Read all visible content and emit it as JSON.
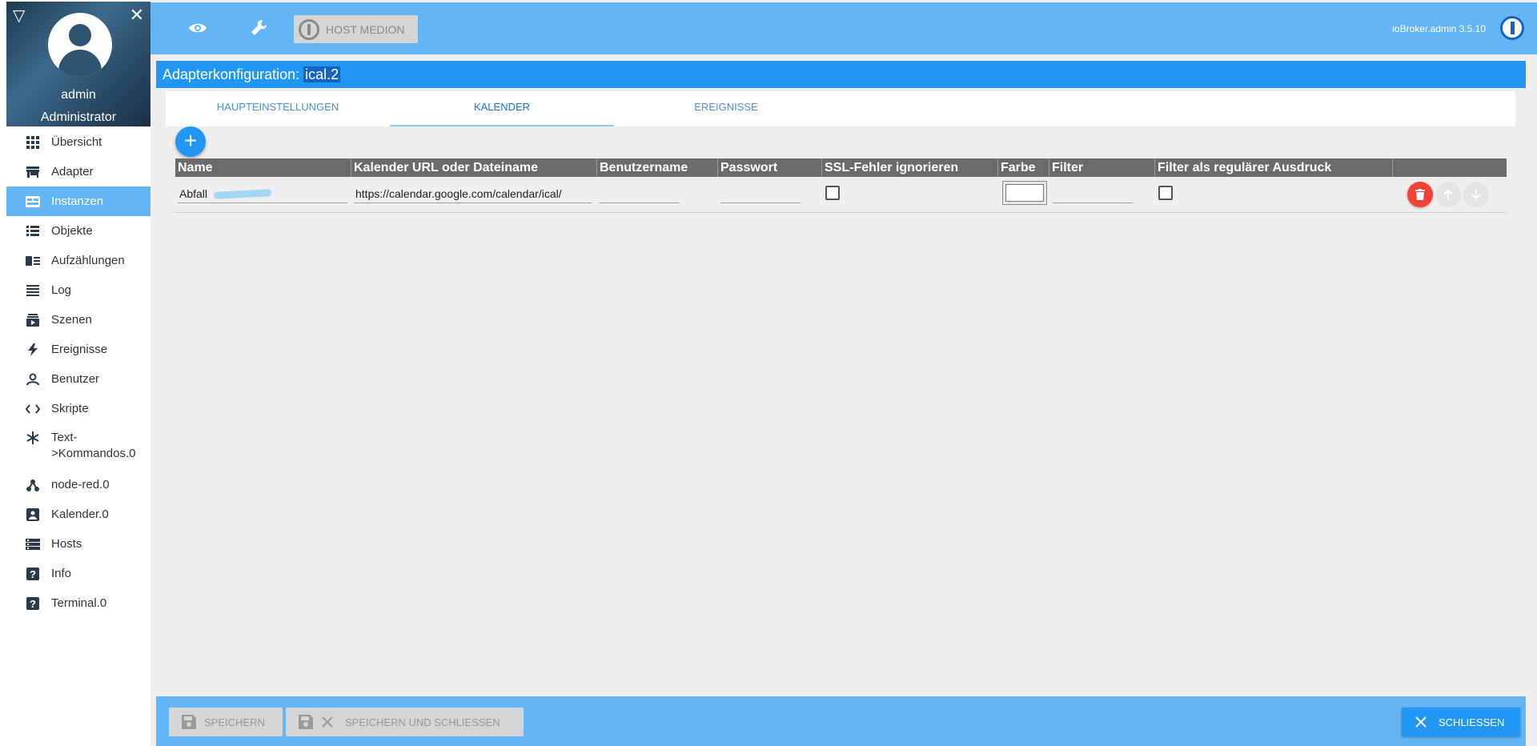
{
  "sidebar": {
    "user": {
      "name": "admin",
      "role": "Administrator"
    },
    "items": [
      {
        "label": "Übersicht",
        "icon": "grid-icon"
      },
      {
        "label": "Adapter",
        "icon": "store-icon"
      },
      {
        "label": "Instanzen",
        "icon": "instances-icon",
        "active": true
      },
      {
        "label": "Objekte",
        "icon": "list-icon"
      },
      {
        "label": "Aufzählungen",
        "icon": "enum-icon"
      },
      {
        "label": "Log",
        "icon": "log-icon"
      },
      {
        "label": "Szenen",
        "icon": "scenes-icon"
      },
      {
        "label": "Ereignisse",
        "icon": "flash-icon"
      },
      {
        "label": "Benutzer",
        "icon": "user-icon"
      },
      {
        "label": "Skripte",
        "icon": "code-icon"
      },
      {
        "label1": "Text-",
        "label2": ">Kommandos.0",
        "icon": "snowflake-icon"
      },
      {
        "label": "node-red.0",
        "icon": "nodes-icon"
      },
      {
        "label": "Kalender.0",
        "icon": "calendar-icon"
      },
      {
        "label": "Hosts",
        "icon": "server-icon"
      },
      {
        "label": "Info",
        "icon": "help-icon"
      },
      {
        "label": "Terminal.0",
        "icon": "terminal-icon"
      }
    ]
  },
  "topbar": {
    "host_label": "HOST MEDION",
    "version": "ioBroker.admin 3.5.10"
  },
  "adapter": {
    "title_prefix": "Adapterkonfiguration:",
    "instance": "ical.2"
  },
  "tabs": [
    {
      "label": "HAUPTEINSTELLUNGEN"
    },
    {
      "label": "KALENDER",
      "active": true
    },
    {
      "label": "EREIGNISSE"
    }
  ],
  "table": {
    "headers": {
      "name": "Name",
      "url": "Kalender URL oder Dateiname",
      "user": "Benutzername",
      "password": "Passwort",
      "ssl": "SSL-Fehler ignorieren",
      "color": "Farbe",
      "filter": "Filter",
      "regex": "Filter als regulärer Ausdruck"
    },
    "rows": [
      {
        "name": "Abfall",
        "url": "https://calendar.google.com/calendar/ical/",
        "user": "",
        "password": "",
        "ssl": false,
        "color": "#ffffff",
        "filter": "",
        "regex": false
      }
    ]
  },
  "footer": {
    "save": "SPEICHERN",
    "save_close": "SPEICHERN UND SCHLIESSEN",
    "close": "SCHLIESSEN"
  },
  "colors": {
    "primary": "#2196f3",
    "light_primary": "#64b5f6",
    "delete": "#f44336"
  }
}
